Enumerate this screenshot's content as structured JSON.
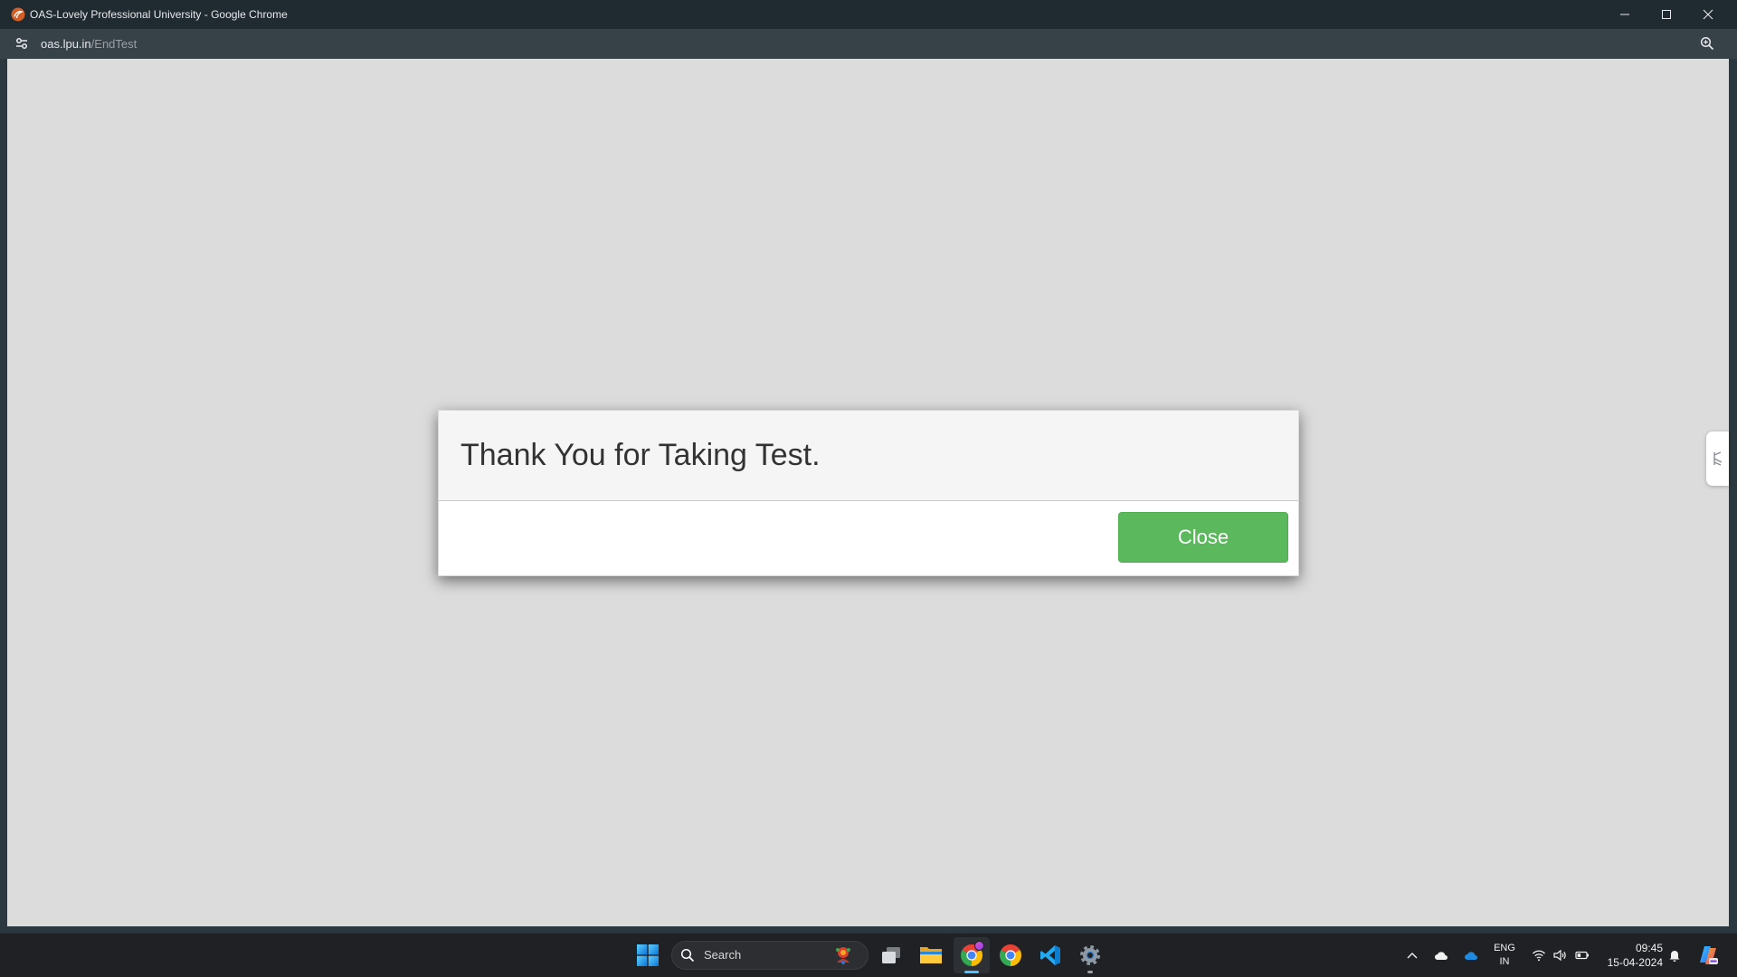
{
  "browser": {
    "window_title": "OAS-Lovely Professional University - Google Chrome",
    "url_host": "oas.lpu.in",
    "url_path": "/EndTest",
    "icons": {
      "favicon": "lpu-favicon-icon",
      "site_info": "site-settings-icon",
      "zoom": "zoom-in-icon",
      "minimize": "minimize-icon",
      "maximize": "maximize-icon",
      "close": "close-icon",
      "side_panel": "side-panel-toggle-icon"
    }
  },
  "dialog": {
    "message": "Thank You for Taking Test.",
    "close_label": "Close"
  },
  "taskbar": {
    "search_label": "Search",
    "pinned_icons": [
      "windows-start-icon",
      "task-view-icon",
      "file-explorer-icon",
      "chrome-icon",
      "chrome-icon",
      "vscode-icon",
      "settings-icon"
    ],
    "active_app_icon": "chrome-icon",
    "tray": {
      "icons": [
        "chevron-up-icon",
        "cloud-icon",
        "onedrive-icon",
        "wifi-icon",
        "volume-icon",
        "battery-icon",
        "bell-icon",
        "copilot-icon"
      ],
      "language": "ENG",
      "region": "IN",
      "time": "09:45",
      "date": "15-04-2024"
    }
  },
  "colors": {
    "titlebar": "#202b31",
    "toolbar": "#364148",
    "page": "#dcdcdc",
    "dialog-header": "#f5f5f5",
    "close": "#5cb85c",
    "taskbar": "#1f2124",
    "active-indicator": "#4cc2ff"
  }
}
